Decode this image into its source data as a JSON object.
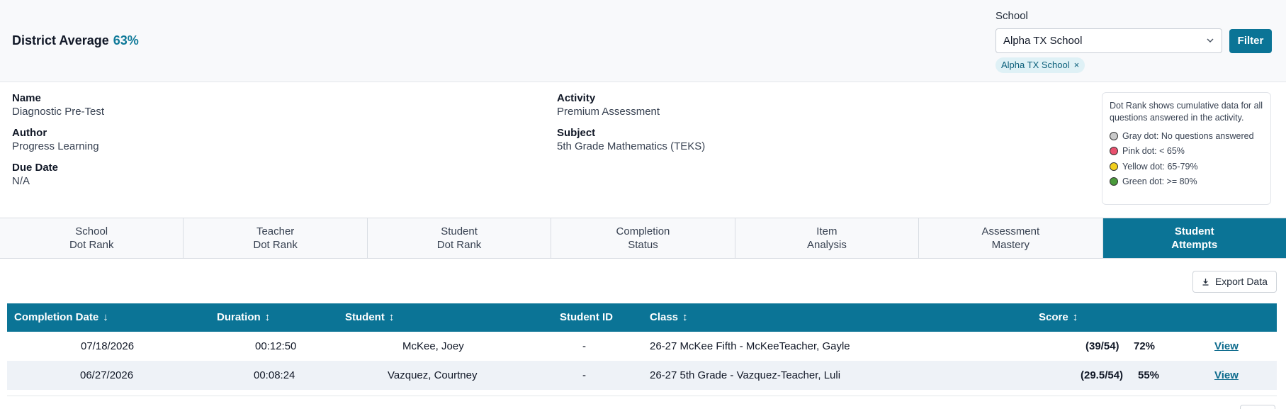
{
  "header": {
    "district_label": "District Average",
    "district_pct": "63%",
    "school_label": "School",
    "school_selected": "Alpha TX School",
    "filter_label": "Filter",
    "chip_label": "Alpha TX School",
    "chip_close": "×"
  },
  "info": {
    "name_label": "Name",
    "name_value": "Diagnostic Pre-Test",
    "author_label": "Author",
    "author_value": "Progress Learning",
    "due_label": "Due Date",
    "due_value": "N/A",
    "activity_label": "Activity",
    "activity_value": "Premium Assessment",
    "subject_label": "Subject",
    "subject_value": "5th Grade Mathematics (TEKS)"
  },
  "legend": {
    "description": "Dot Rank shows cumulative data for all questions answered in the activity.",
    "items": [
      {
        "label": "Gray dot: No questions answered",
        "color": "#c9c9c9"
      },
      {
        "label": "Pink dot: < 65%",
        "color": "#e8506e"
      },
      {
        "label": "Yellow dot: 65-79%",
        "color": "#f2cf1d"
      },
      {
        "label": "Green dot: >= 80%",
        "color": "#4a9a3b"
      }
    ]
  },
  "tabs": [
    {
      "line1": "School",
      "line2": "Dot Rank"
    },
    {
      "line1": "Teacher",
      "line2": "Dot Rank"
    },
    {
      "line1": "Student",
      "line2": "Dot Rank"
    },
    {
      "line1": "Completion",
      "line2": "Status"
    },
    {
      "line1": "Item",
      "line2": "Analysis"
    },
    {
      "line1": "Assessment",
      "line2": "Mastery"
    },
    {
      "line1": "Student",
      "line2": "Attempts"
    }
  ],
  "export_label": "Export Data",
  "table": {
    "headers": {
      "completion_date": "Completion Date",
      "duration": "Duration",
      "student": "Student",
      "student_id": "Student ID",
      "class": "Class",
      "score": "Score"
    },
    "sort_down": "↓",
    "sort_both": "↕",
    "rows": [
      {
        "date": "07/18/2026",
        "duration": "00:12:50",
        "student": "McKee, Joey",
        "student_id": "-",
        "class": "26-27 McKee Fifth - McKeeTeacher, Gayle",
        "score_frac": "(39/54)",
        "score_pct": "72%",
        "action": "View"
      },
      {
        "date": "06/27/2026",
        "duration": "00:08:24",
        "student": "Vazquez, Courtney",
        "student_id": "-",
        "class": "26-27 5th Grade - Vazquez-Teacher, Luli",
        "score_frac": "(29.5/54)",
        "score_pct": "55%",
        "action": "View"
      }
    ]
  },
  "colors": {
    "accent": "#0b7496",
    "district_pct": "#107a99"
  }
}
